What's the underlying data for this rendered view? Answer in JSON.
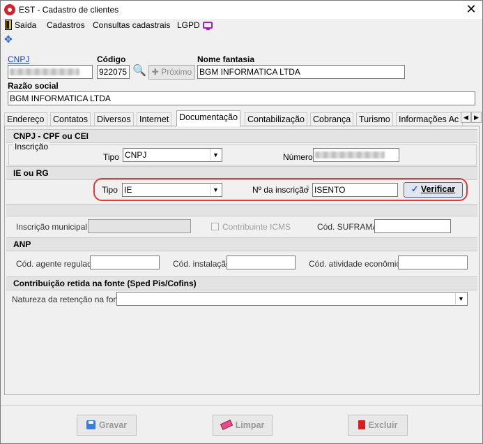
{
  "window": {
    "title": "EST - Cadastro de clientes"
  },
  "menu": {
    "items": [
      "Saída",
      "Cadastros",
      "Consultas cadastrais",
      "LGPD"
    ]
  },
  "header": {
    "cnpj_label": "CNPJ",
    "codigo_label": "Código",
    "codigo_value": "922075",
    "proximo_label": "Próximo",
    "nome_fantasia_label": "Nome fantasia",
    "nome_fantasia_value": "BGM INFORMATICA LTDA",
    "razao_social_label": "Razão social",
    "razao_social_value": "BGM INFORMATICA LTDA"
  },
  "tabs": [
    {
      "label": "Endereço"
    },
    {
      "label": "Contatos"
    },
    {
      "label": "Diversos"
    },
    {
      "label": "Internet"
    },
    {
      "label": "Documentação",
      "active": true
    },
    {
      "label": "Contabilização"
    },
    {
      "label": "Cobrança"
    },
    {
      "label": "Turismo"
    },
    {
      "label": "Informações Ac"
    }
  ],
  "documentacao": {
    "cnpj_section": "CNPJ - CPF ou CEI",
    "inscricao_group": "Inscrição",
    "tipo_label": "Tipo",
    "tipo_value": "CNPJ",
    "numero_label": "Número",
    "ie_section": "IE ou RG",
    "ie_tipo_label": "Tipo",
    "ie_tipo_value": "IE",
    "ie_numero_label": "Nº da inscrição",
    "ie_numero_value": "ISENTO",
    "verificar_label": "Verificar",
    "inscricao_municipal_label": "Inscrição municipal",
    "contribuinte_icms_label": "Contribuinte ICMS",
    "suframa_label": "Cód. SUFRAMA",
    "anp_section": "ANP",
    "agente_label": "Cód. agente regulado",
    "instalacao_label": "Cód. instalação",
    "atividade_label": "Cód. atividade econômica",
    "retida_section": "Contribuição retida na fonte  (Sped Pis/Cofins)",
    "natureza_label": "Natureza da retenção na fonte"
  },
  "footer": {
    "gravar": "Gravar",
    "limpar": "Limpar",
    "excluir": "Excluir"
  },
  "colors": {
    "highlight": "#e03a3a",
    "link": "#1a3fc8",
    "accent": "#2a5fd8"
  }
}
